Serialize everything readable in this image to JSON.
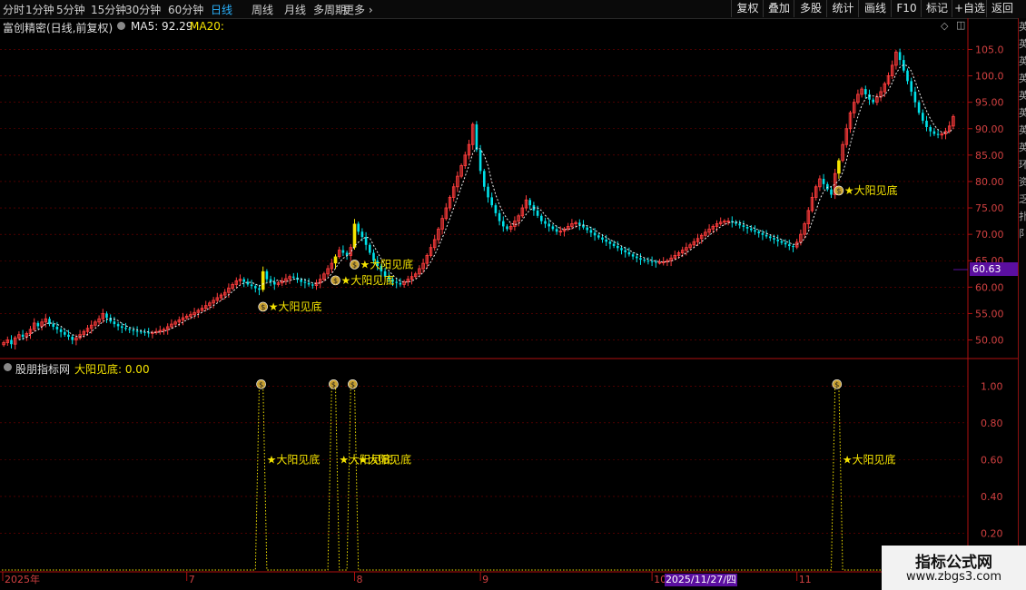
{
  "toolbar": {
    "period_tabs": [
      "分时",
      "1分钟",
      "5分钟",
      "15分钟",
      "30分钟",
      "60分钟",
      "日线",
      "周线",
      "月线",
      "多周期",
      "更多"
    ],
    "active_tab": "日线",
    "right_buttons": [
      "复权",
      "叠加",
      "多股",
      "统计",
      "画线",
      "F10",
      "标记",
      "+自选",
      "返回"
    ]
  },
  "main_chart": {
    "title": "富创精密(日线,前复权)",
    "ma5_label": "MA5: 92.29",
    "ma20_label": "MA20:",
    "current_price": "60.63",
    "price_axis_labels": [
      "105.0",
      "100.0",
      "95.00",
      "90.00",
      "85.00",
      "80.00",
      "75.00",
      "70.00",
      "65.00",
      "60.00",
      "55.00",
      "50.00"
    ]
  },
  "indicator": {
    "title": "股朋指标网",
    "value_label": "大阳见底: 0.00",
    "axis_labels": [
      "1.00",
      "0.80",
      "0.60",
      "0.40",
      "0.20"
    ]
  },
  "x_axis": {
    "labels": [
      "2025年",
      "7",
      "8",
      "9",
      "10",
      "11",
      "1"
    ],
    "cursor_date": "2025/11/27/四"
  },
  "signal_label": "★大阳见底",
  "sidebar_chars": [
    "英",
    "英",
    "英",
    "英",
    "英",
    "英",
    "英",
    "英",
    "环",
    "资",
    "乏",
    "扑",
    "阝"
  ],
  "watermark": {
    "title": "指标公式网",
    "url": "www.zbgs3.com"
  },
  "colors": {
    "up": "#ff3c3c",
    "down": "#00e0e8",
    "signal": "#f5e400",
    "grid": "#7a0000",
    "axis": "#b01010",
    "accent": "#2ab3ff"
  },
  "chart_data": {
    "type": "candlestick",
    "title": "富创精密(日线,前复权)",
    "ylim": [
      47,
      108
    ],
    "indicator_ylim": [
      0,
      1.1
    ],
    "month_labels": [
      "2025年",
      "7",
      "8",
      "9",
      "10",
      "11",
      "1"
    ],
    "signal_indices": [
      68,
      87,
      92,
      219
    ],
    "closes": [
      49.5,
      50,
      49.2,
      50.4,
      51,
      50.6,
      51.2,
      52,
      53.2,
      52.6,
      53.4,
      54,
      53,
      52.5,
      52,
      51.5,
      51,
      50.6,
      50,
      50.4,
      51,
      51.6,
      52.2,
      52.8,
      53.4,
      54,
      55,
      54.2,
      53.5,
      53,
      52.6,
      52.3,
      52.1,
      51.9,
      51.7,
      51.6,
      51.5,
      51.4,
      51.3,
      51.4,
      51.6,
      51.8,
      52,
      52.5,
      53,
      53.4,
      53.8,
      54.2,
      54.5,
      54.8,
      55.2,
      55.6,
      56,
      56.5,
      57,
      57.5,
      58,
      58.5,
      59,
      59.8,
      60.5,
      61.2,
      61.5,
      61,
      60.5,
      60.2,
      59.8,
      59.5,
      63,
      61.5,
      61,
      60.5,
      60.8,
      61.2,
      61.6,
      62,
      61.8,
      61.4,
      61,
      60.8,
      60.5,
      60.3,
      60.8,
      61.5,
      62.5,
      63.5,
      64.5,
      65.8,
      67,
      66.5,
      66,
      67.5,
      72,
      70.5,
      69.5,
      68,
      66.5,
      65,
      64,
      63,
      62,
      61.5,
      61,
      60.8,
      60.5,
      61,
      61.5,
      62,
      62.5,
      63.5,
      64.5,
      66,
      67.5,
      69,
      71,
      73,
      75,
      77,
      79,
      81,
      83,
      85,
      87,
      90.8,
      86,
      82,
      79,
      77,
      75.5,
      74,
      72.5,
      71.5,
      71,
      71.5,
      72.5,
      73.5,
      75,
      76.5,
      75.5,
      74.5,
      73.5,
      72.5,
      72,
      71.5,
      71,
      70.5,
      70.6,
      71,
      71.5,
      72,
      72.2,
      71.8,
      71.3,
      70.8,
      70.3,
      69.8,
      69.4,
      69,
      68.6,
      68.2,
      67.8,
      67.4,
      67,
      66.6,
      66.2,
      65.8,
      65.5,
      65.2,
      65,
      64.9,
      64.8,
      64.7,
      64.7,
      64.8,
      65,
      65.5,
      66,
      66.5,
      67,
      67.5,
      68,
      68.6,
      69.2,
      69.8,
      70.4,
      71,
      71.5,
      72,
      72.3,
      72.5,
      72.5,
      72.3,
      72,
      71.7,
      71.4,
      71.1,
      70.8,
      70.5,
      70.2,
      69.9,
      69.6,
      69.3,
      69,
      68.7,
      68.4,
      68.1,
      67.8,
      67.6,
      68.5,
      70,
      72,
      74.5,
      77,
      79,
      80.5,
      79.5,
      78.5,
      77.5,
      81.5,
      84,
      87,
      90,
      93,
      95,
      96.5,
      97.5,
      96.5,
      95.5,
      95,
      96,
      97,
      98.5,
      100,
      102,
      104.5,
      103,
      101,
      99,
      97,
      95,
      93,
      91.5,
      90.3,
      89.5,
      89,
      88.8,
      89,
      89.5,
      90.5,
      92.3
    ]
  }
}
